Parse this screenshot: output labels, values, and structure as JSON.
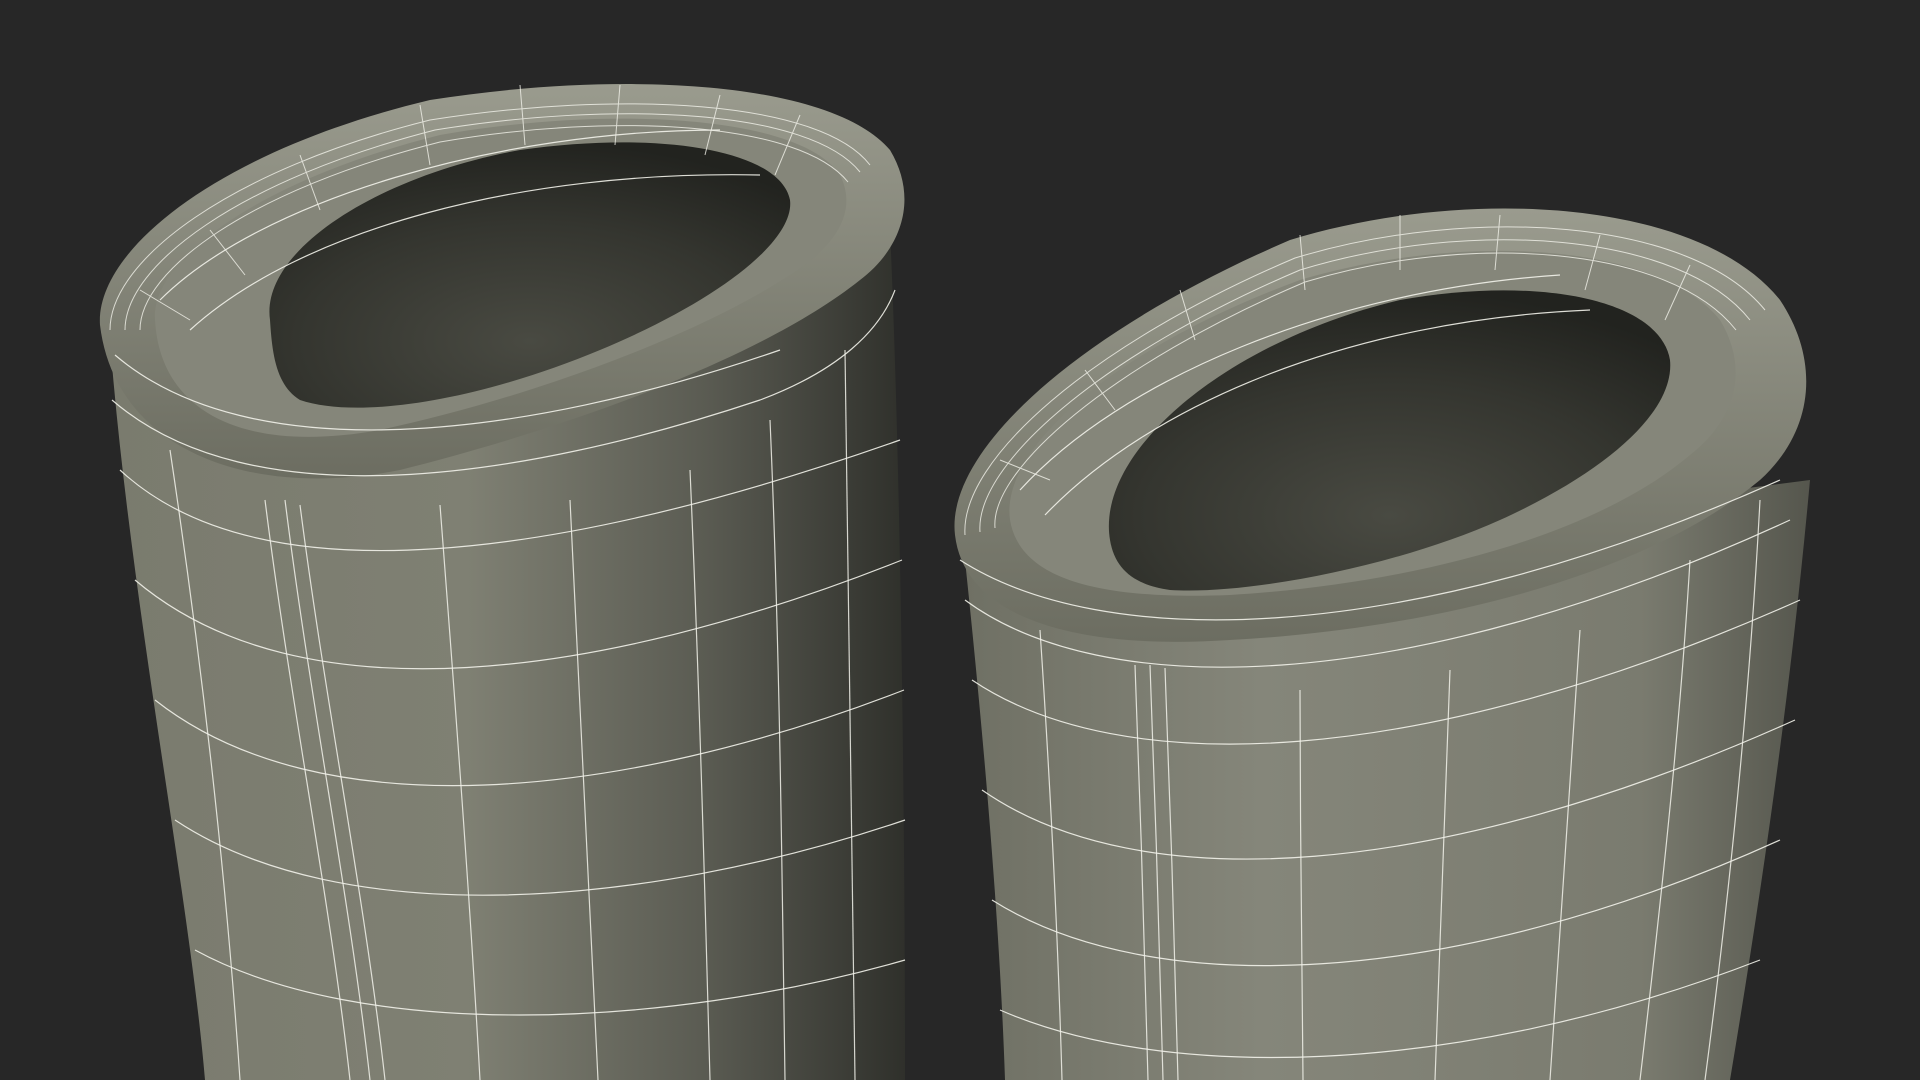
{
  "scene": {
    "background_color": "#272727",
    "surface_color": "#7e7f72",
    "surface_shadow_color": "#34352f",
    "inner_color": "#2f302a",
    "wire_color": "#f2f2ea",
    "objects": [
      {
        "name": "left-boot-shaft"
      },
      {
        "name": "right-boot-shaft"
      }
    ]
  }
}
